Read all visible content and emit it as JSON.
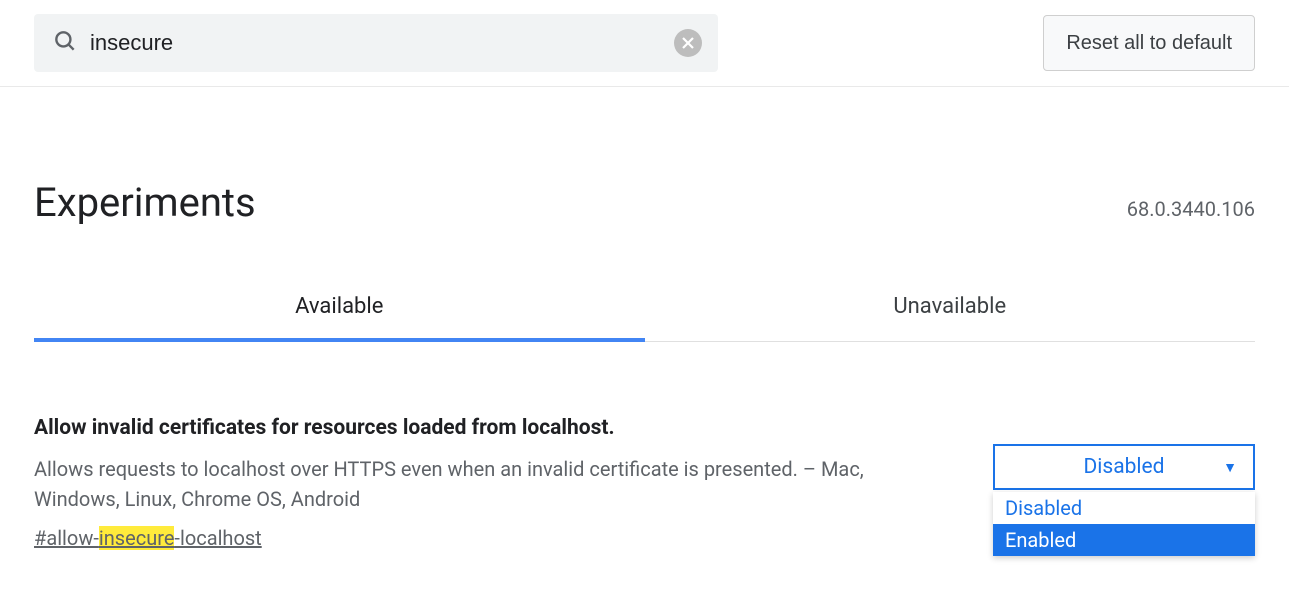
{
  "search": {
    "value": "insecure"
  },
  "reset_button": "Reset all to default",
  "page_title": "Experiments",
  "version": "68.0.3440.106",
  "tabs": {
    "available": "Available",
    "unavailable": "Unavailable"
  },
  "flag": {
    "title": "Allow invalid certificates for resources loaded from localhost.",
    "description": "Allows requests to localhost over HTTPS even when an invalid certificate is presented. – Mac, Windows, Linux, Chrome OS, Android",
    "anchor_pre": "#allow-",
    "anchor_hl": "insecure",
    "anchor_post": "-localhost",
    "selected": "Disabled",
    "options": {
      "disabled": "Disabled",
      "enabled": "Enabled"
    }
  }
}
